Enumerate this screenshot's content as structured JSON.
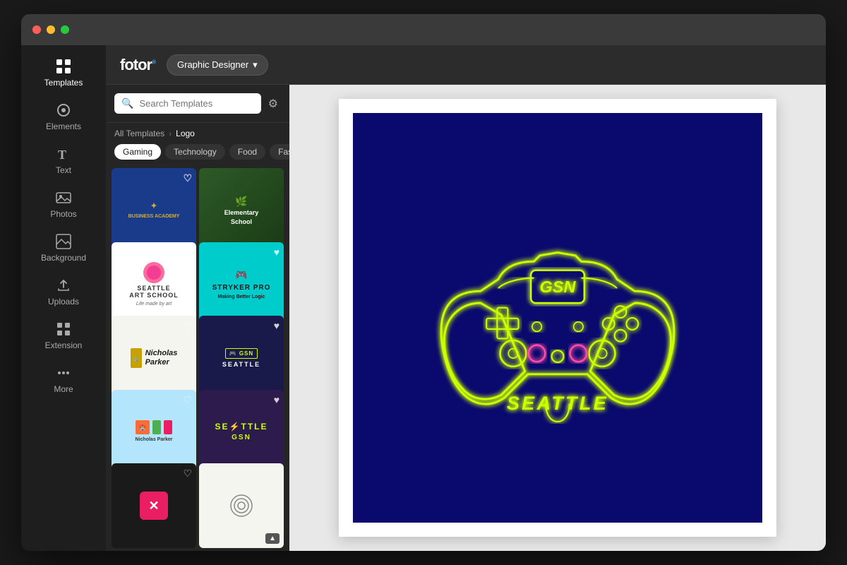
{
  "window": {
    "title": "Fotor Graphic Designer"
  },
  "topbar": {
    "logo": "fotor",
    "app_selector": "Graphic Designer",
    "app_selector_arrow": "▾"
  },
  "sidebar": {
    "items": [
      {
        "id": "templates",
        "label": "Templates",
        "icon": "grid-icon"
      },
      {
        "id": "elements",
        "label": "Elements",
        "icon": "elements-icon"
      },
      {
        "id": "text",
        "label": "Text",
        "icon": "text-icon"
      },
      {
        "id": "photos",
        "label": "Photos",
        "icon": "photos-icon"
      },
      {
        "id": "background",
        "label": "Background",
        "icon": "background-icon"
      },
      {
        "id": "uploads",
        "label": "Uploads",
        "icon": "uploads-icon"
      },
      {
        "id": "extension",
        "label": "Extension",
        "icon": "extension-icon"
      },
      {
        "id": "more",
        "label": "More",
        "icon": "more-icon"
      }
    ]
  },
  "templates_panel": {
    "search_placeholder": "Search Templates",
    "breadcrumb": {
      "parent": "All Templates",
      "separator": "›",
      "current": "Logo"
    },
    "categories": [
      {
        "id": "gaming",
        "label": "Gaming",
        "active": true
      },
      {
        "id": "technology",
        "label": "Technology",
        "active": false
      },
      {
        "id": "food",
        "label": "Food",
        "active": false
      },
      {
        "id": "fashion",
        "label": "Fashion",
        "active": false
      }
    ],
    "templates": [
      {
        "id": "t1",
        "type": "blue-academy",
        "title": "Business Academy"
      },
      {
        "id": "t2",
        "type": "elementary",
        "title": "Elementary School"
      },
      {
        "id": "t3",
        "type": "seattle-art",
        "title": "Seattle Art School"
      },
      {
        "id": "t4",
        "type": "stryker",
        "title": "Stryker Pro"
      },
      {
        "id": "t5",
        "type": "nicholas",
        "title": "Nicholas Parker"
      },
      {
        "id": "t6",
        "type": "gsn-dark",
        "title": "GSN Seattle"
      },
      {
        "id": "t7",
        "type": "light-blue",
        "title": "Nicholas Parker Light"
      },
      {
        "id": "t8",
        "type": "purple-seattle",
        "title": "Seattle GSN"
      },
      {
        "id": "t9",
        "type": "dark-cross",
        "title": "Cross Logo"
      },
      {
        "id": "t10",
        "type": "spiral",
        "title": "Spiral Logo"
      }
    ]
  },
  "canvas": {
    "label": "GSN Seattle Controller Logo",
    "controller_text_gsn": "GSN",
    "controller_text_seattle": "SEATTLE"
  },
  "scroll_btn_label": "▲"
}
